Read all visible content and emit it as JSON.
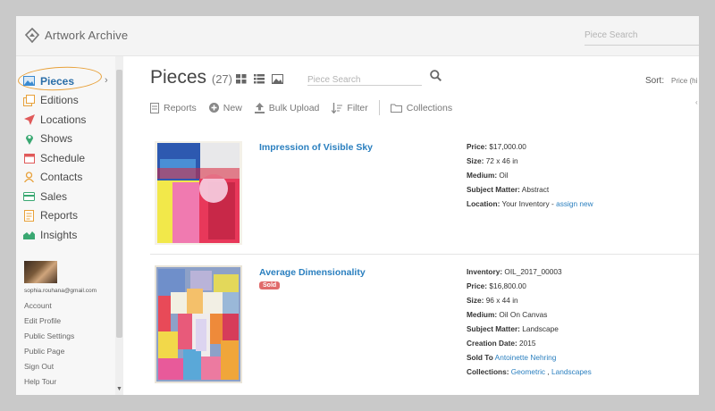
{
  "app": {
    "name": "Artwork Archive",
    "top_search_placeholder": "Piece Search"
  },
  "sidebar": {
    "items": [
      {
        "label": "Pieces",
        "icon": "image-icon",
        "color": "#3a8bd1"
      },
      {
        "label": "Editions",
        "icon": "editions-icon",
        "color": "#e8a13a"
      },
      {
        "label": "Locations",
        "icon": "location-arrow-icon",
        "color": "#e05a5a"
      },
      {
        "label": "Shows",
        "icon": "map-pin-icon",
        "color": "#3aa872"
      },
      {
        "label": "Schedule",
        "icon": "calendar-icon",
        "color": "#e05a5a"
      },
      {
        "label": "Contacts",
        "icon": "contact-icon",
        "color": "#e8a13a"
      },
      {
        "label": "Sales",
        "icon": "credit-card-icon",
        "color": "#3aa872"
      },
      {
        "label": "Reports",
        "icon": "report-icon",
        "color": "#e8a13a"
      },
      {
        "label": "Insights",
        "icon": "area-chart-icon",
        "color": "#3aa872"
      }
    ],
    "user_email": "sophia.rouhana@gmail.com",
    "links": [
      "Account",
      "Edit Profile",
      "Public Settings",
      "Public Page",
      "Sign Out",
      "Help Tour"
    ]
  },
  "main": {
    "title": "Pieces",
    "count": "(27)",
    "search_placeholder": "Piece Search",
    "sort_label": "Sort:",
    "sort_value": "Price (hi",
    "toolbar": {
      "reports": "Reports",
      "new": "New",
      "bulk_upload": "Bulk Upload",
      "filter": "Filter",
      "collections": "Collections"
    }
  },
  "pieces": [
    {
      "title": "Impression of Visible Sky",
      "details": {
        "price_label": "Price:",
        "price": "$17,000.00",
        "size_label": "Size:",
        "size": "72 x 46 in",
        "medium_label": "Medium:",
        "medium": "Oil",
        "subject_label": "Subject Matter:",
        "subject": "Abstract",
        "location_label": "Location:",
        "location": "Your Inventory",
        "location_sep": " - ",
        "location_link": "assign new"
      }
    },
    {
      "title": "Average Dimensionality",
      "badge": "Sold",
      "details": {
        "inventory_label": "Inventory:",
        "inventory": "OIL_2017_00003",
        "price_label": "Price:",
        "price": "$16,800.00",
        "size_label": "Size:",
        "size": "96 x 44 in",
        "medium_label": "Medium:",
        "medium": "Oil On Canvas",
        "subject_label": "Subject Matter:",
        "subject": "Landscape",
        "creation_label": "Creation Date:",
        "creation": "2015",
        "sold_label": "Sold To",
        "sold_to": "Antoinette Nehring",
        "collections_label": "Collections:",
        "collection_1": "Geometric",
        "collection_sep": " , ",
        "collection_2": "Landscapes"
      }
    }
  ]
}
